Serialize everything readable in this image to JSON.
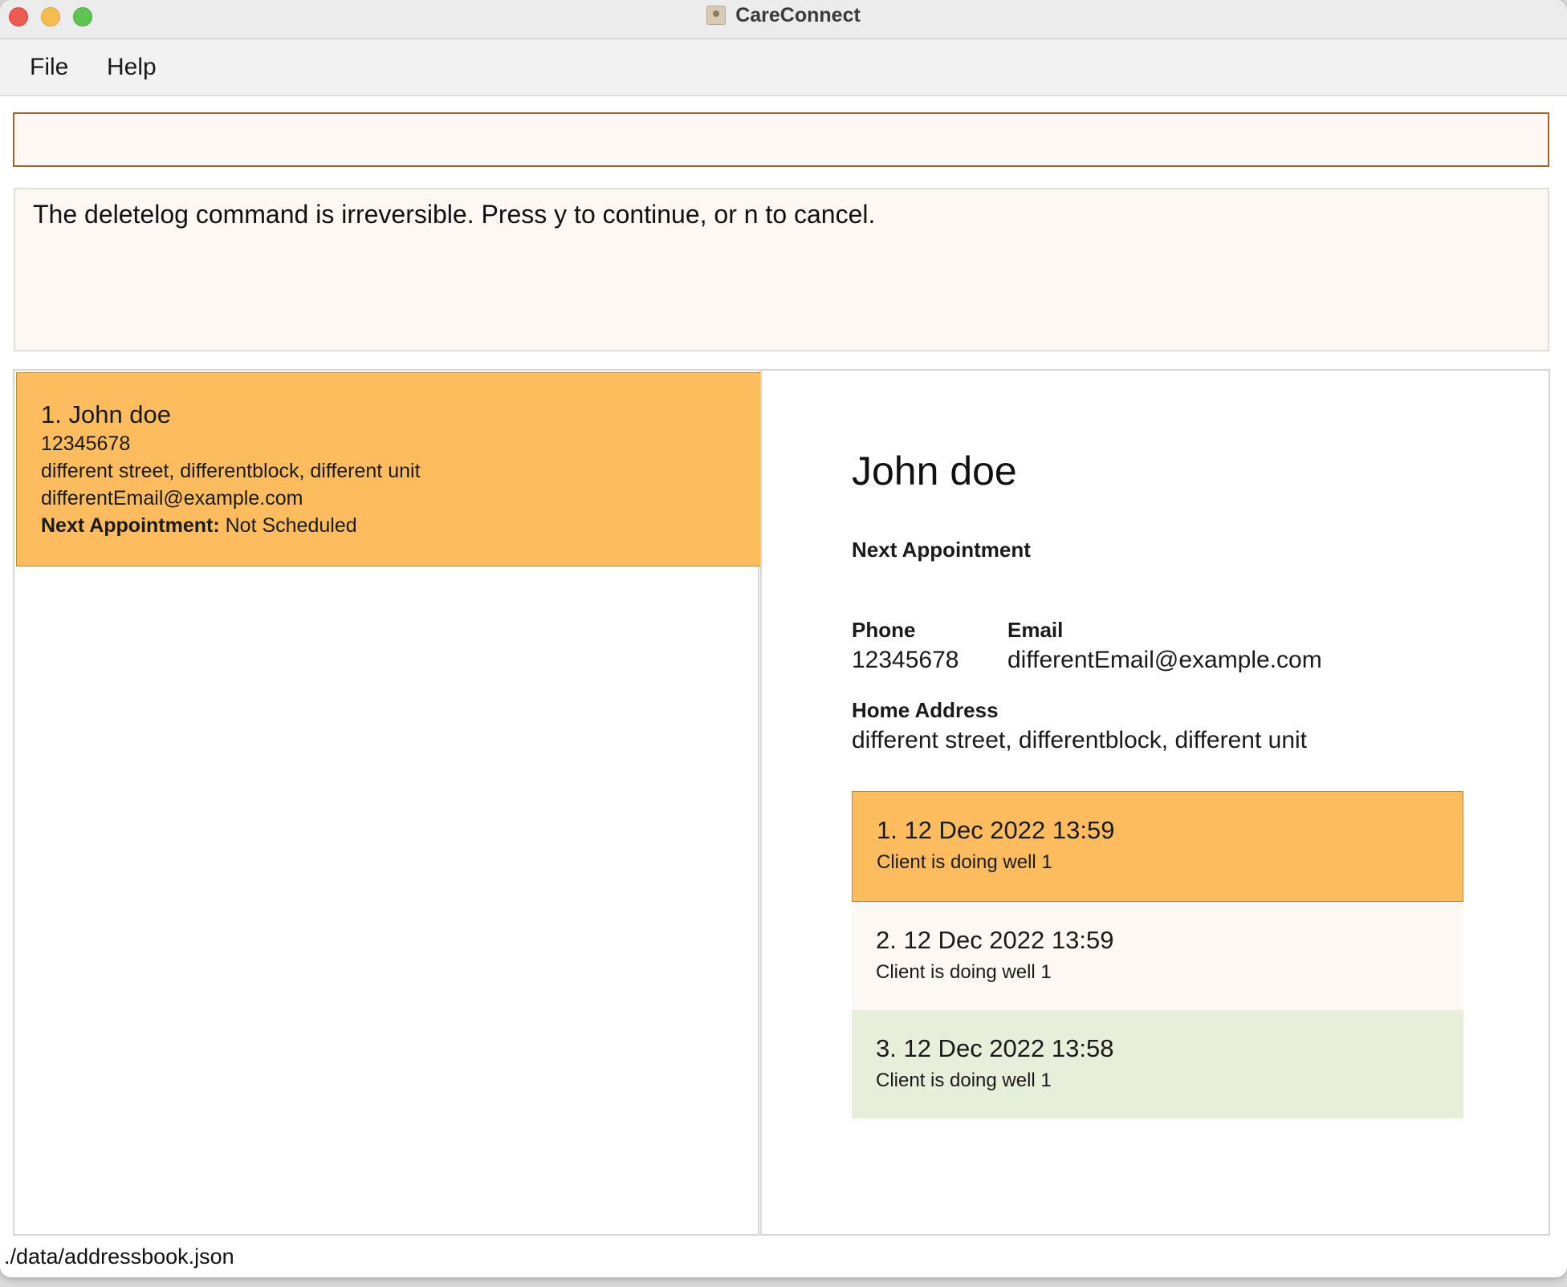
{
  "window": {
    "title": "CareConnect",
    "icon": "contacts-book-icon"
  },
  "menu": {
    "items": [
      {
        "label": "File"
      },
      {
        "label": "Help"
      }
    ]
  },
  "command": {
    "value": "",
    "placeholder": ""
  },
  "result": {
    "message": "The deletelog command is irreversible. Press y to continue, or n to cancel."
  },
  "person_list": [
    {
      "index_name": "1. John doe",
      "phone": "12345678",
      "address": "different street, differentblock, different unit",
      "email": "differentEmail@example.com",
      "appointment_label": "Next Appointment:",
      "appointment_value": "Not Scheduled"
    }
  ],
  "detail": {
    "name": "John doe",
    "appointment_label": "Next Appointment",
    "phone_label": "Phone",
    "phone": "12345678",
    "email_label": "Email",
    "email": "differentEmail@example.com",
    "address_label": "Home Address",
    "address": "different street, differentblock, different unit",
    "logs": [
      {
        "date": "1. 12 Dec 2022 13:59",
        "note": "Client is doing well 1"
      },
      {
        "date": "2. 12 Dec 2022 13:59",
        "note": "Client is doing well 1"
      },
      {
        "date": "3. 12 Dec 2022 13:58",
        "note": "Client is doing well 1"
      }
    ]
  },
  "status": {
    "file_path": "./data/addressbook.json"
  },
  "colors": {
    "selected": "#fdbd5f",
    "panel_bg": "#fdf8f3",
    "alt_row": "#e7eed9",
    "command_border": "#a66321"
  }
}
